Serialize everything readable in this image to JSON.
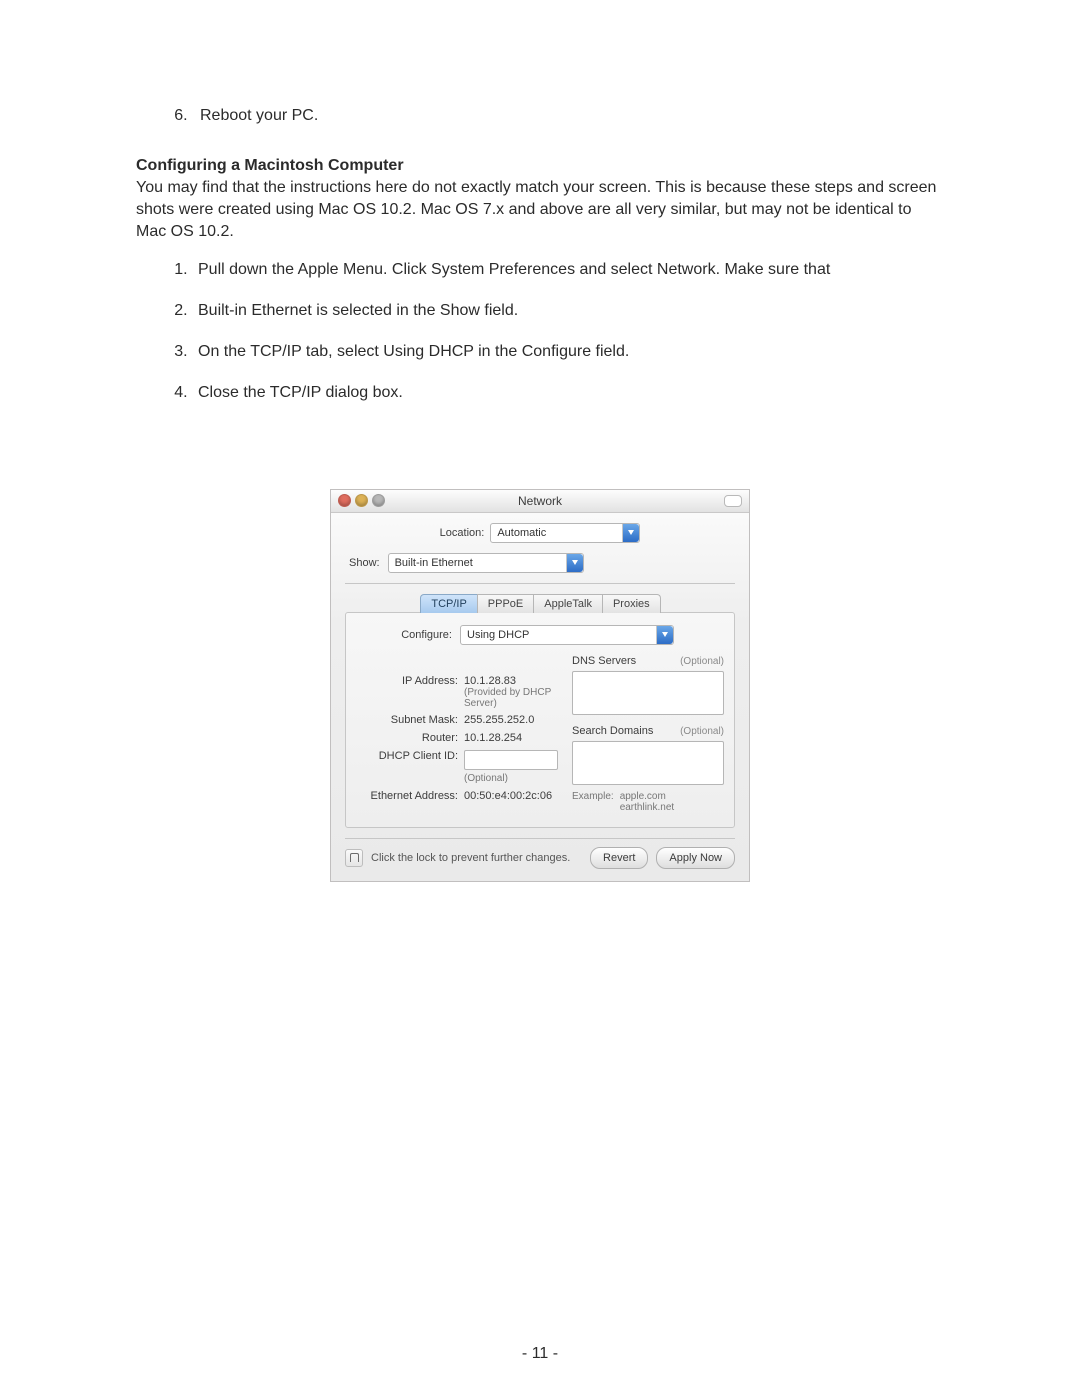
{
  "doc": {
    "step6": "Reboot your PC.",
    "heading": "Configuring a Macintosh Computer",
    "paragraph": "You may find that the instructions here do not exactly match your screen. This is because these steps and screen shots were created using Mac OS 10.2. Mac OS 7.x and above are all very similar, but may not be identical to Mac OS 10.2.",
    "steps": [
      "Pull down the Apple Menu. Click System Preferences and select Network. Make sure that",
      "Built-in Ethernet is selected in the Show field.",
      "On the TCP/IP tab, select Using DHCP in the Configure field.",
      "Close the TCP/IP dialog box."
    ],
    "page_number": "- 11 -"
  },
  "win": {
    "title": "Network",
    "location_label": "Location:",
    "location_value": "Automatic",
    "show_label": "Show:",
    "show_value": "Built-in Ethernet",
    "tabs": {
      "tcpip": "TCP/IP",
      "pppoe": "PPPoE",
      "appletalk": "AppleTalk",
      "proxies": "Proxies"
    },
    "configure_label": "Configure:",
    "configure_value": "Using DHCP",
    "ip_label": "IP Address:",
    "ip_value": "10.1.28.83",
    "ip_sub": "(Provided by DHCP Server)",
    "subnet_label": "Subnet Mask:",
    "subnet_value": "255.255.252.0",
    "router_label": "Router:",
    "router_value": "10.1.28.254",
    "dhcp_label": "DHCP Client ID:",
    "dhcp_sub": "(Optional)",
    "eth_label": "Ethernet Address:",
    "eth_value": "00:50:e4:00:2c:06",
    "dns_label": "DNS Servers",
    "dns_opt": "(Optional)",
    "search_label": "Search Domains",
    "search_opt": "(Optional)",
    "example_label": "Example:",
    "example_value1": "apple.com",
    "example_value2": "earthlink.net",
    "lock_text": "Click the lock to prevent further changes.",
    "revert": "Revert",
    "apply": "Apply Now"
  }
}
